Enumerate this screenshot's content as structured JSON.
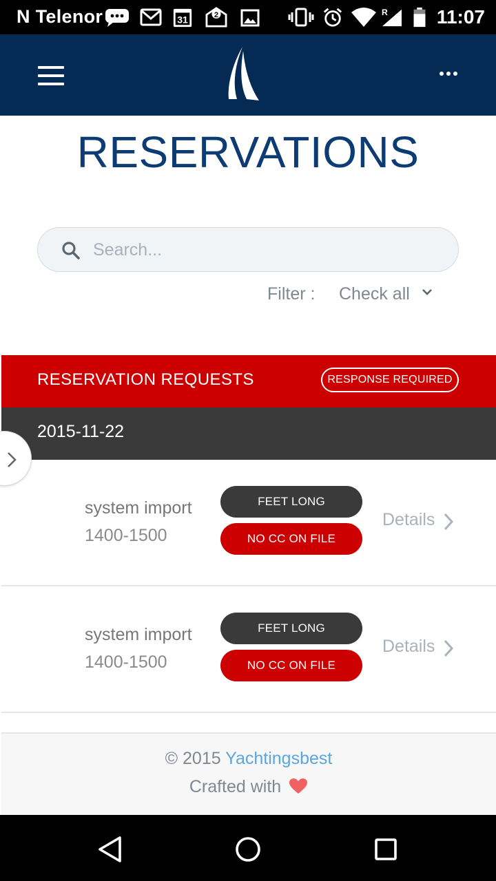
{
  "status_bar": {
    "carrier": "N Telenor",
    "time": "11:07",
    "icons": [
      "chat-icon",
      "gmail-icon",
      "calendar-icon",
      "mail-icon",
      "image-icon",
      "vibrate-icon",
      "alarm-icon",
      "wifi-icon",
      "signal-icon",
      "battery-icon"
    ],
    "calendar_day": "31",
    "mail_count": "2",
    "roaming": "R"
  },
  "header": {
    "menu_icon": "hamburger-icon",
    "logo": "sail-logo",
    "more_icon": "more-dots-icon",
    "color": "#052b55"
  },
  "page": {
    "title": "RESERVATIONS"
  },
  "search": {
    "placeholder": "Search...",
    "value": ""
  },
  "filter": {
    "label": "Filter :",
    "value": "Check all"
  },
  "requests": {
    "title": "RESERVATION REQUESTS",
    "badge": "RESPONSE REQUIRED",
    "color": "#cc0000",
    "date": "2015-11-22",
    "items": [
      {
        "name": "system import",
        "time": "1400-1500",
        "tag1": "FEET LONG",
        "tag2": "NO CC ON FILE",
        "details": "Details"
      },
      {
        "name": "system import",
        "time": "1400-1500",
        "tag1": "FEET LONG",
        "tag2": "NO CC ON FILE",
        "details": "Details"
      }
    ]
  },
  "footer": {
    "copyright": "© 2015",
    "brand": "Yachtingsbest",
    "crafted": "Crafted with"
  },
  "nav": {
    "back": "back-triangle-icon",
    "home": "home-circle-icon",
    "recents": "recents-square-icon"
  }
}
